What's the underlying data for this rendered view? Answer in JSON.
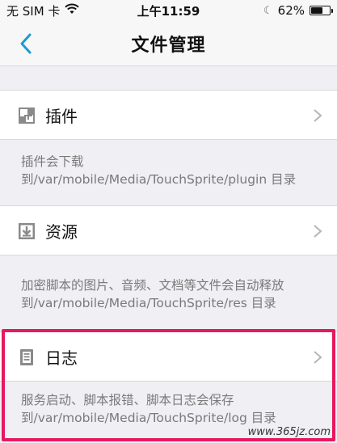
{
  "status_bar": {
    "carrier": "无 SIM 卡",
    "time": "上午11:59",
    "battery_text": "62%",
    "battery_level": 0.62
  },
  "nav": {
    "title": "文件管理"
  },
  "items": [
    {
      "label": "插件",
      "description": "插件会下载到/var/mobile/Media/TouchSprite/plugin 目录"
    },
    {
      "label": "资源",
      "description": "加密脚本的图片、音频、文档等文件会自动释放到/var/mobile/Media/TouchSprite/res 目录"
    },
    {
      "label": "日志",
      "description": "服务启动、脚本报错、脚本日志会保存到/var/mobile/Media/TouchSprite/log 目录"
    }
  ],
  "watermark": "www.365jz.com",
  "colors": {
    "accent": "#1a9bd6",
    "highlight": "#e8185f"
  }
}
